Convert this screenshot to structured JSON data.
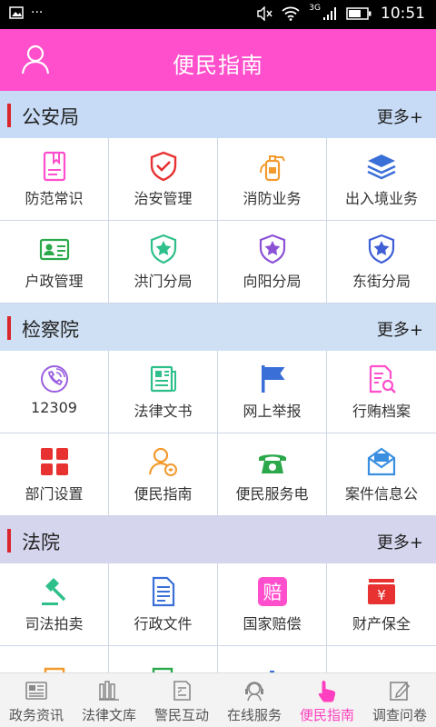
{
  "status": {
    "time": "10:51",
    "network": "3G",
    "dots": "···"
  },
  "header": {
    "title": "便民指南"
  },
  "sections": [
    {
      "name": "公安局",
      "more": "更多+",
      "items": [
        {
          "label": "防范常识"
        },
        {
          "label": "治安管理"
        },
        {
          "label": "消防业务"
        },
        {
          "label": "出入境业务"
        },
        {
          "label": "户政管理"
        },
        {
          "label": "洪门分局"
        },
        {
          "label": "向阳分局"
        },
        {
          "label": "东街分局"
        }
      ]
    },
    {
      "name": "检察院",
      "more": "更多+",
      "items": [
        {
          "label": "12309"
        },
        {
          "label": "法律文书"
        },
        {
          "label": "网上举报"
        },
        {
          "label": "行贿档案"
        },
        {
          "label": "部门设置"
        },
        {
          "label": "便民指南"
        },
        {
          "label": "便民服务电"
        },
        {
          "label": "案件信息公"
        }
      ]
    },
    {
      "name": "法院",
      "more": "更多+",
      "items": [
        {
          "label": "司法拍卖"
        },
        {
          "label": "行政文件"
        },
        {
          "label": "国家赔偿",
          "icon_text": "赔"
        },
        {
          "label": "财产保全",
          "icon_text": "¥"
        }
      ]
    }
  ],
  "tabs": [
    {
      "label": "政务资讯"
    },
    {
      "label": "法律文库"
    },
    {
      "label": "警民互动"
    },
    {
      "label": "在线服务"
    },
    {
      "label": "便民指南"
    },
    {
      "label": "调查问卷"
    }
  ],
  "colors": {
    "header": "#ff4fcc",
    "active_tab": "#ff3fbf",
    "police_bg": "#c7dbf7",
    "procuratorate_bg": "#cfe0f4",
    "court_bg": "#d5d5ee"
  }
}
